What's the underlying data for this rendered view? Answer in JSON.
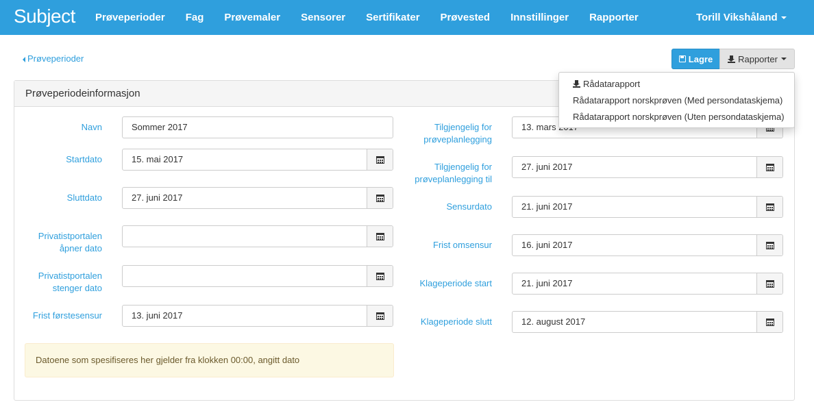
{
  "navbar": {
    "brand": "Subject",
    "items": [
      "Prøveperioder",
      "Fag",
      "Prøvemaler",
      "Sensorer",
      "Sertifikater",
      "Prøvested",
      "Innstillinger",
      "Rapporter"
    ],
    "user": "Torill Vikshåland",
    "background_color": "#2f9fdd"
  },
  "breadcrumb": {
    "back_label": "Prøveperioder"
  },
  "toolbar": {
    "save_label": "Lagre",
    "reports_label": "Rapporter"
  },
  "dropdown": {
    "items": [
      {
        "label": "Rådatarapport",
        "icon": "download-icon"
      },
      {
        "label": "Rådatarapport norskprøven (Med persondataskjema)"
      },
      {
        "label": "Rådatarapport norskprøven (Uten persondataskjema)"
      }
    ]
  },
  "panel": {
    "title": "Prøveperiodeinformasjon"
  },
  "left_fields": [
    {
      "label_lines": [
        "Navn"
      ],
      "value": "Sommer 2017",
      "has_calendar": false
    },
    {
      "label_lines": [
        "Startdato"
      ],
      "value": "15. mai 2017",
      "has_calendar": true
    },
    {
      "label_lines": [
        "Sluttdato"
      ],
      "value": "27. juni 2017",
      "has_calendar": true
    },
    {
      "label_lines": [
        "Privatistportalen",
        "åpner dato"
      ],
      "value": "",
      "has_calendar": true
    },
    {
      "label_lines": [
        "Privatistportalen",
        "stenger dato"
      ],
      "value": "",
      "has_calendar": true
    },
    {
      "label_lines": [
        "Frist førstesensur"
      ],
      "value": "13. juni 2017",
      "has_calendar": true
    }
  ],
  "right_fields": [
    {
      "label_lines": [
        "Tilgjengelig for",
        "prøveplanlegging"
      ],
      "value": "13. mars 2017",
      "has_calendar": true
    },
    {
      "label_lines": [
        "Tilgjengelig for",
        "prøveplanlegging til"
      ],
      "value": "27. juni 2017",
      "has_calendar": true
    },
    {
      "label_lines": [
        "Sensurdato"
      ],
      "value": "21. juni 2017",
      "has_calendar": true
    },
    {
      "label_lines": [
        "Frist omsensur"
      ],
      "value": "16. juni 2017",
      "has_calendar": true
    },
    {
      "label_lines": [
        "Klageperiode start"
      ],
      "value": "21. juni 2017",
      "has_calendar": true
    },
    {
      "label_lines": [
        "Klageperiode slutt"
      ],
      "value": "12. august 2017",
      "has_calendar": true
    }
  ],
  "note": {
    "text": "Datoene som spesifiseres her gjelder fra klokken 00:00, angitt dato"
  }
}
